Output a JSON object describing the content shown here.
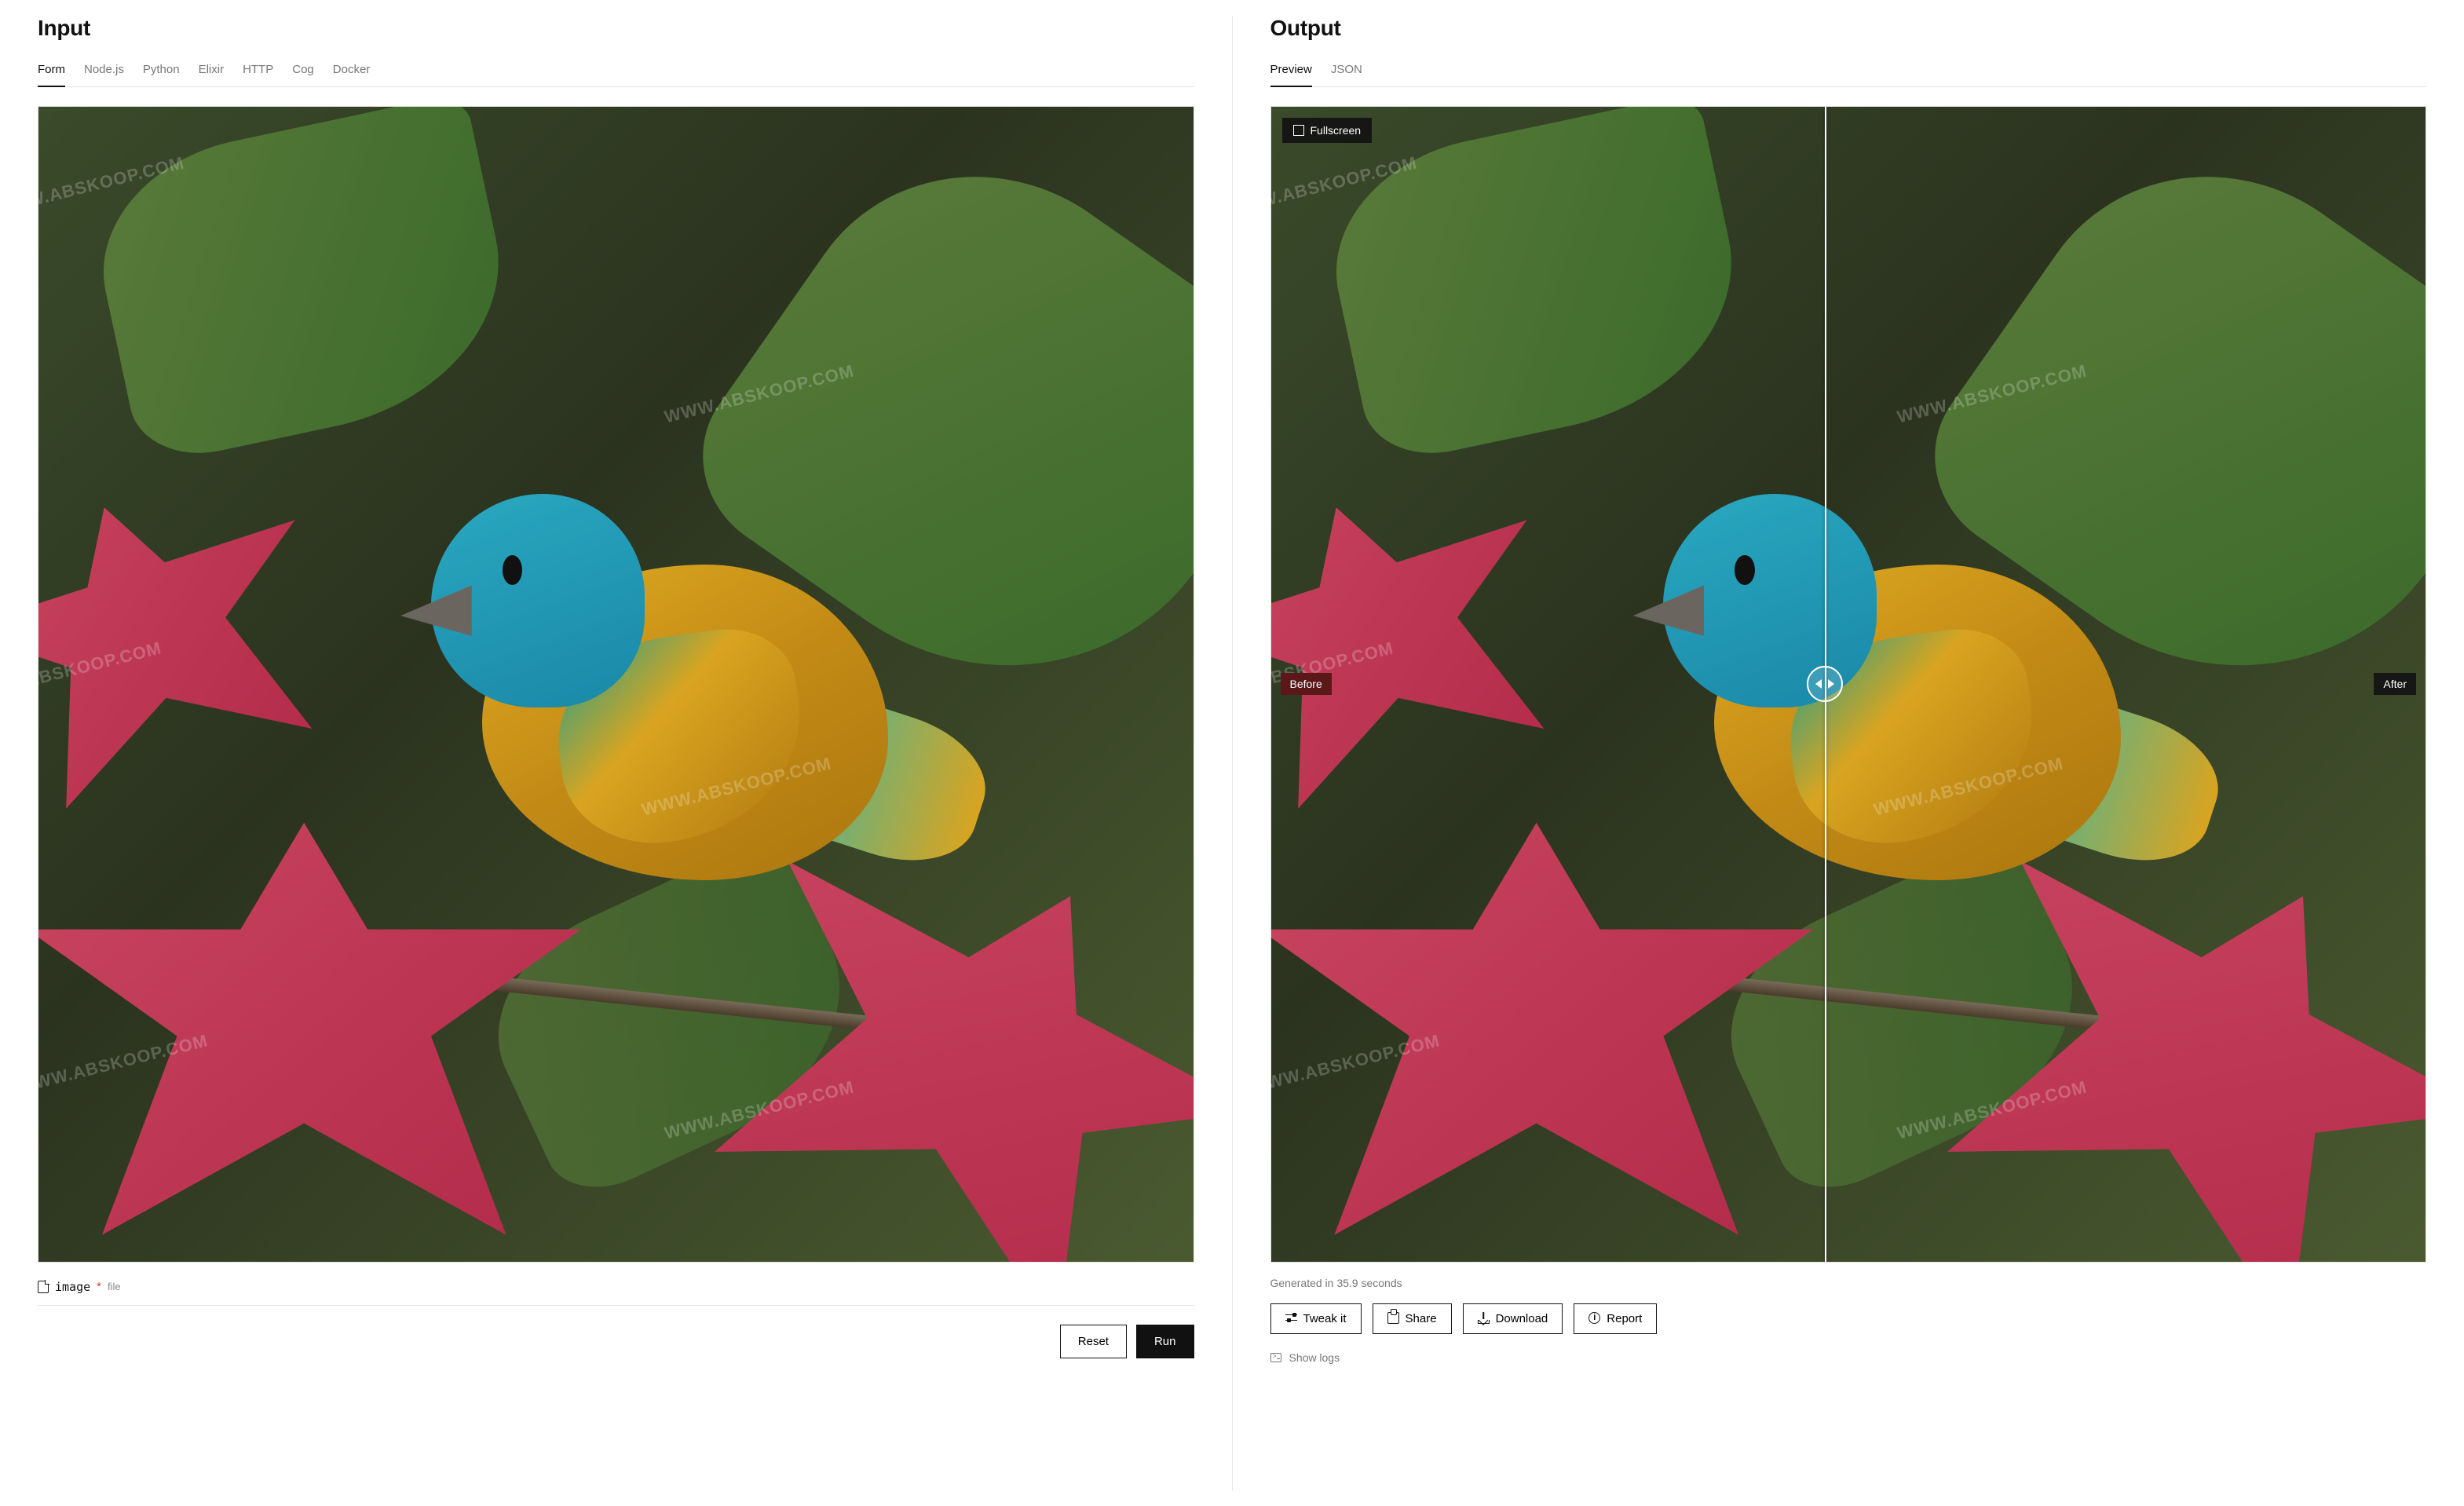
{
  "input": {
    "title": "Input",
    "tabs": [
      "Form",
      "Node.js",
      "Python",
      "Elixir",
      "HTTP",
      "Cog",
      "Docker"
    ],
    "active_tab": "Form",
    "field": {
      "name": "image",
      "required_marker": "*",
      "type_hint": "file"
    },
    "buttons": {
      "reset": "Reset",
      "run": "Run"
    }
  },
  "output": {
    "title": "Output",
    "tabs": [
      "Preview",
      "JSON"
    ],
    "active_tab": "Preview",
    "fullscreen_label": "Fullscreen",
    "compare": {
      "before_label": "Before",
      "after_label": "After"
    },
    "generated_line": "Generated in 35.9 seconds",
    "actions": {
      "tweak": "Tweak it",
      "share": "Share",
      "download": "Download",
      "report": "Report"
    },
    "show_logs": "Show logs"
  },
  "watermark_text": "WWW.ABSKOOP.COM"
}
